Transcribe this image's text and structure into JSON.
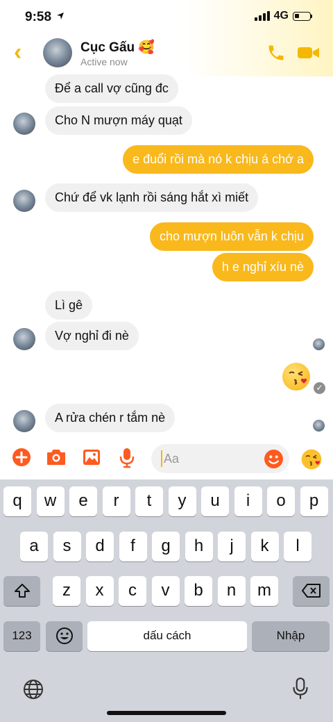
{
  "status_bar": {
    "time": "9:58",
    "network": "4G"
  },
  "header": {
    "name": "Cục Gấu",
    "name_emoji": "🥰",
    "status": "Active now"
  },
  "messages": [
    {
      "dir": "in",
      "text": "Để a call vợ cũng đc"
    },
    {
      "dir": "in",
      "text": "Cho N mượn máy quạt"
    },
    {
      "dir": "out",
      "text": "e đuổi rồi mà nó k chịu á chớ a"
    },
    {
      "dir": "in",
      "text": "Chứ để vk lạnh rồi sáng hắt xì miết"
    },
    {
      "dir": "out",
      "text": "cho mượn luôn vẫn k chịu"
    },
    {
      "dir": "out",
      "text": "h e nghỉ xíu nè"
    },
    {
      "dir": "in",
      "text": "Lì gê"
    },
    {
      "dir": "in",
      "text": "Vợ nghỉ đi nè"
    },
    {
      "dir": "out",
      "text": "😘"
    },
    {
      "dir": "in",
      "text": "A rửa chén r tắm nè"
    }
  ],
  "composer": {
    "placeholder": "Aa",
    "icons": [
      "plus-icon",
      "camera-icon",
      "gallery-icon",
      "mic-icon",
      "emoji-icon",
      "kiss-emoji-icon"
    ]
  },
  "keyboard": {
    "row1": [
      "q",
      "w",
      "e",
      "r",
      "t",
      "y",
      "u",
      "i",
      "o",
      "p"
    ],
    "row2": [
      "a",
      "s",
      "d",
      "f",
      "g",
      "h",
      "j",
      "k",
      "l"
    ],
    "row3": [
      "z",
      "x",
      "c",
      "v",
      "b",
      "n",
      "m"
    ],
    "num_label": "123",
    "space_label": "dấu cách",
    "return_label": "Nhập"
  },
  "colors": {
    "accent": "#f9b81c",
    "incoming_bubble": "#f0f0f0",
    "composer_icons": "#ff5a1f"
  }
}
